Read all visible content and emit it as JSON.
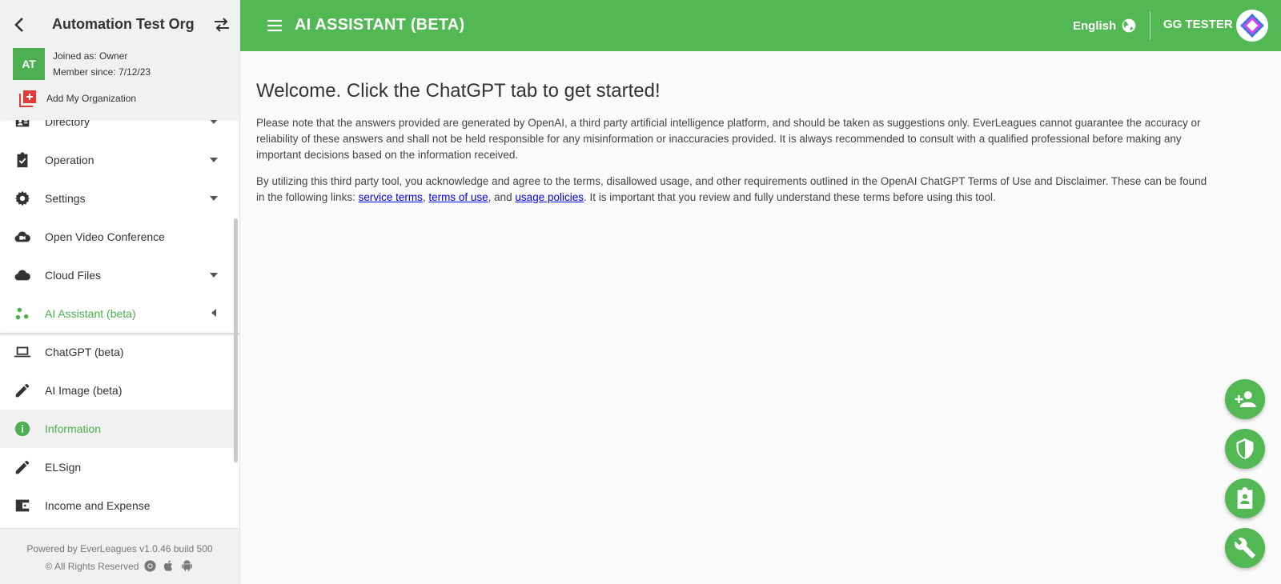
{
  "sidebar": {
    "org_name": "Automation Test Org",
    "avatar_initials": "AT",
    "joined_as": "Joined as: Owner",
    "member_since": "Member since: 7/12/23",
    "add_org_label": "Add My Organization",
    "items": [
      {
        "label": "Directory"
      },
      {
        "label": "Operation"
      },
      {
        "label": "Settings"
      },
      {
        "label": "Open Video Conference"
      },
      {
        "label": "Cloud Files"
      },
      {
        "label": "AI Assistant (beta)"
      },
      {
        "label": "ChatGPT (beta)"
      },
      {
        "label": "AI Image (beta)"
      },
      {
        "label": "Information"
      },
      {
        "label": "ELSign"
      },
      {
        "label": "Income and Expense"
      }
    ],
    "footer_powered": "Powered by EverLeagues v1.0.46 build 500",
    "footer_rights": "© All Rights Reserved"
  },
  "header": {
    "title": "AI ASSISTANT (BETA)",
    "language": "English",
    "user_name": "GG TESTER"
  },
  "main": {
    "welcome": "Welcome. Click the ChatGPT tab to get started!",
    "para1": "Please note that the answers provided are generated by OpenAI, a third party artificial intelligence platform, and should be taken as suggestions only. EverLeagues cannot guarantee the accuracy or reliability of these answers and shall not be held responsible for any misinformation or inaccuracies provided. It is always recommended to consult with a qualified professional before making any important decisions based on the information received.",
    "para2_prefix": "By utilizing this third party tool, you acknowledge and agree to the terms, disallowed usage, and other requirements outlined in the OpenAI ChatGPT Terms of Use and Disclaimer. These can be found in the following links: ",
    "link_service_terms": "service terms",
    "sep1": ", ",
    "link_terms_of_use": "terms of use",
    "sep2": ", and ",
    "link_usage_policies": "usage policies",
    "para2_suffix": ". It is important that you review and fully understand these terms before using this tool."
  },
  "colors": {
    "brand_green": "#52b853",
    "active_green": "#4caf50"
  }
}
